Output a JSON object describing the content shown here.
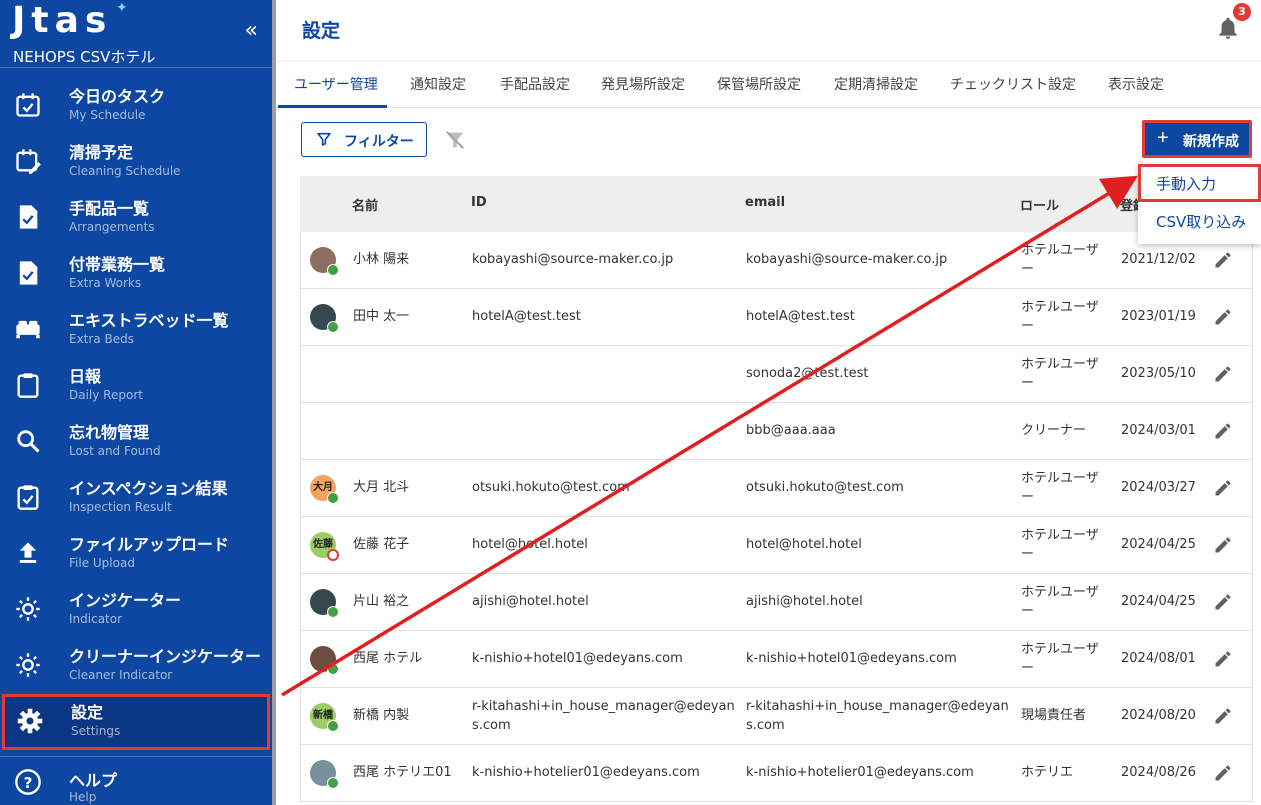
{
  "app": {
    "logo": "Jtas",
    "hotel_name": "NEHOPS CSVホテル",
    "collapse_icon": "«"
  },
  "sidebar": {
    "items": [
      {
        "ja": "今日のタスク",
        "en": "My Schedule",
        "icon": "calendar-check-icon"
      },
      {
        "ja": "清掃予定",
        "en": "Cleaning Schedule",
        "icon": "calendar-edit-icon"
      },
      {
        "ja": "手配品一覧",
        "en": "Arrangements",
        "icon": "document-check-icon"
      },
      {
        "ja": "付帯業務一覧",
        "en": "Extra Works",
        "icon": "document-check-icon"
      },
      {
        "ja": "エキストラベッド一覧",
        "en": "Extra Beds",
        "icon": "bed-icon"
      },
      {
        "ja": "日報",
        "en": "Daily Report",
        "icon": "clipboard-icon"
      },
      {
        "ja": "忘れ物管理",
        "en": "Lost and Found",
        "icon": "search-icon"
      },
      {
        "ja": "インスペクション結果",
        "en": "Inspection Result",
        "icon": "clipboard-check-icon"
      },
      {
        "ja": "ファイルアップロード",
        "en": "File Upload",
        "icon": "upload-icon"
      },
      {
        "ja": "インジケーター",
        "en": "Indicator",
        "icon": "sun-icon"
      },
      {
        "ja": "クリーナーインジケーター",
        "en": "Cleaner Indicator",
        "icon": "sun-icon"
      },
      {
        "ja": "設定",
        "en": "Settings",
        "icon": "gear-icon"
      }
    ],
    "help": {
      "ja": "ヘルプ",
      "en": "Help"
    }
  },
  "header": {
    "title": "設定",
    "notification_count": "3"
  },
  "tabs": [
    "ユーザー管理",
    "通知設定",
    "手配品設定",
    "発見場所設定",
    "保管場所設定",
    "定期清掃設定",
    "チェックリスト設定",
    "表示設定"
  ],
  "toolbar": {
    "filter_label": "フィルター",
    "new_label": "新規作成",
    "new_icon": "+"
  },
  "new_menu": {
    "manual": "手動入力",
    "csv": "CSV取り込み"
  },
  "table": {
    "headers": {
      "name": "名前",
      "id": "ID",
      "email": "email",
      "role": "ロール",
      "registered": "登録"
    },
    "rows": [
      {
        "avatar": "",
        "avatar_color": "#8d6e63",
        "status": "ok",
        "name": "小林 陽来",
        "id": "kobayashi@source-maker.co.jp",
        "email": "kobayashi@source-maker.co.jp",
        "role": "ホテルユーザー",
        "date": "2021/12/02"
      },
      {
        "avatar": "",
        "avatar_color": "#37474f",
        "status": "ok",
        "name": "田中 太一",
        "id": "hotelA@test.test",
        "email": "hotelA@test.test",
        "role": "ホテルユーザー",
        "date": "2023/01/19"
      },
      {
        "avatar": "",
        "avatar_color": "",
        "status": "",
        "name": "",
        "id": "",
        "email": "sonoda2@test.test",
        "role": "ホテルユーザー",
        "date": "2023/05/10"
      },
      {
        "avatar": "",
        "avatar_color": "",
        "status": "",
        "name": "",
        "id": "",
        "email": "bbb@aaa.aaa",
        "role": "クリーナー",
        "date": "2024/03/01"
      },
      {
        "avatar": "大月",
        "avatar_color": "#f4a460",
        "status": "ok",
        "name": "大月 北斗",
        "id": "otsuki.hokuto@test.com",
        "email": "otsuki.hokuto@test.com",
        "role": "ホテルユーザー",
        "date": "2024/03/27"
      },
      {
        "avatar": "佐藤",
        "avatar_color": "#9ccc65",
        "status": "ng",
        "name": "佐藤 花子",
        "id": "hotel@hotel.hotel",
        "email": "hotel@hotel.hotel",
        "role": "ホテルユーザー",
        "date": "2024/04/25"
      },
      {
        "avatar": "",
        "avatar_color": "#37474f",
        "status": "ok",
        "name": "片山 裕之",
        "id": "ajishi@hotel.hotel",
        "email": "ajishi@hotel.hotel",
        "role": "ホテルユーザー",
        "date": "2024/04/25"
      },
      {
        "avatar": "",
        "avatar_color": "#6d4c41",
        "status": "ok",
        "name": "西尾 ホテル",
        "id": "k-nishio+hotel01@edeyans.com",
        "email": "k-nishio+hotel01@edeyans.com",
        "role": "ホテルユーザー",
        "date": "2024/08/01"
      },
      {
        "avatar": "新橋",
        "avatar_color": "#9ccc65",
        "status": "ok",
        "name": "新橋 内製",
        "id": "r-kitahashi+in_house_manager@edeyans.com",
        "email": "r-kitahashi+in_house_manager@edeyans.com",
        "role": "現場責任者",
        "date": "2024/08/20"
      },
      {
        "avatar": "",
        "avatar_color": "#78909c",
        "status": "ok",
        "name": "西尾 ホテリエ01",
        "id": "k-nishio+hotelier01@edeyans.com",
        "email": "k-nishio+hotelier01@edeyans.com",
        "role": "ホテリエ",
        "date": "2024/08/26"
      }
    ]
  },
  "colors": {
    "primary": "#0d47a1",
    "highlight": "#e53935",
    "status_ok": "#43a047"
  }
}
